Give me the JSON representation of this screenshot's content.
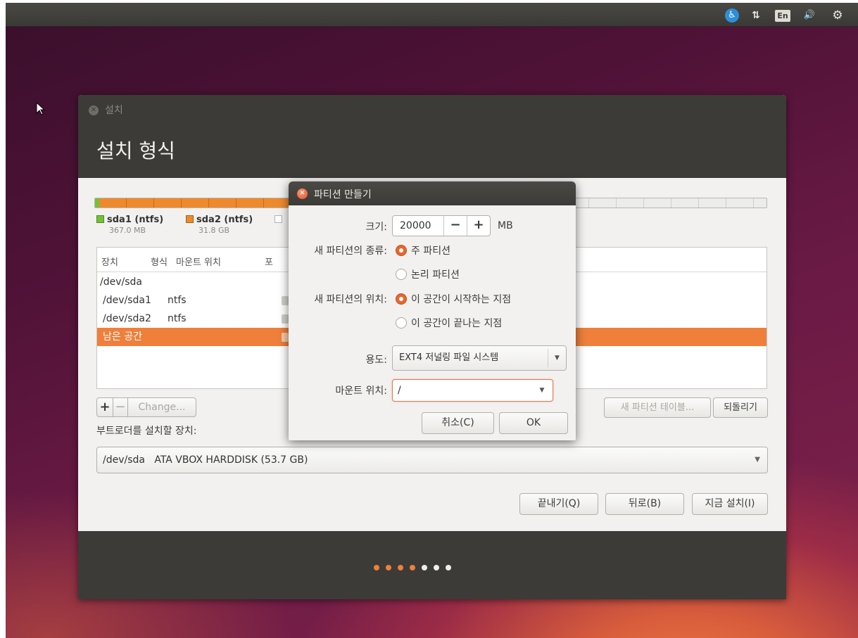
{
  "top_panel": {
    "language_indicator": "En",
    "icons": [
      "accessibility-icon",
      "network-icon",
      "volume-icon",
      "gear-icon"
    ]
  },
  "installer": {
    "window_title": "설치",
    "heading": "설치 형식",
    "legend": [
      {
        "name": "sda1 (ntfs)",
        "size": "367.0 MB",
        "color": "#73c236"
      },
      {
        "name": "sda2 (ntfs)",
        "size": "31.8 GB",
        "color": "#ee8a2c"
      },
      {
        "name": "",
        "size": "",
        "color": "#ffffff"
      }
    ],
    "table": {
      "headers": [
        "장치",
        "형식",
        "마운트 위치",
        "포"
      ],
      "rows": [
        {
          "device": "/dev/sda",
          "type": ""
        },
        {
          "device": "/dev/sda1",
          "type": "ntfs"
        },
        {
          "device": "/dev/sda2",
          "type": "ntfs"
        },
        {
          "device": "남은 공간",
          "type": "",
          "selected": true
        }
      ]
    },
    "buttons": {
      "add": "+",
      "remove": "−",
      "change": "Change...",
      "new_table": "새 파티션 테이블...",
      "revert": "되돌리기",
      "quit": "끝내기(Q)",
      "back": "뒤로(B)",
      "install_now": "지금 설치(I)"
    },
    "bootloader_label": "부트로더를 설치할 장치:",
    "bootloader_device": "/dev/sda   ATA VBOX HARDDISK (53.7 GB)",
    "progress": {
      "total_steps": 7,
      "completed_steps": 4
    },
    "accent_color": "#ef7f3b"
  },
  "dialog": {
    "title": "파티션 만들기",
    "size_label": "크기:",
    "size_value": "20000",
    "decrement": "−",
    "increment": "+",
    "size_unit": "MB",
    "type_label": "새 파티션의 종류:",
    "type_primary": "주 파티션",
    "type_logical": "논리 파티션",
    "location_label": "새 파티션의 위치:",
    "location_start": "이 공간이 시작하는 지점",
    "location_end": "이 공간이 끝나는 지점",
    "use_label": "용도:",
    "use_value": "EXT4 저널링 파일 시스템",
    "mount_label": "마운트 위치:",
    "mount_value": "/",
    "cancel": "취소(C)",
    "ok": "OK"
  }
}
